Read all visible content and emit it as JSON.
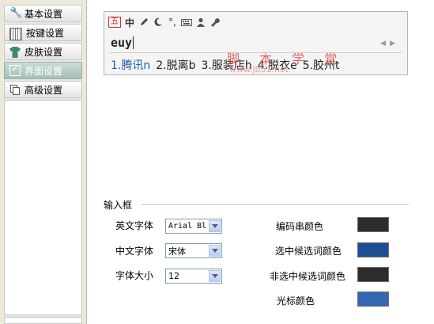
{
  "sidebar": {
    "items": [
      {
        "label": "基本设置",
        "icon": "wrench-icon"
      },
      {
        "label": "按键设置",
        "icon": "keyboard-icon"
      },
      {
        "label": "皮肤设置",
        "icon": "shirt-icon"
      },
      {
        "label": "界面设置",
        "icon": "checkbox-icon",
        "active": true
      },
      {
        "label": "高级设置",
        "icon": "windows-icon"
      }
    ]
  },
  "preview": {
    "toolbar": [
      "五",
      "中",
      "pen-icon",
      "moon-icon",
      "punctuation-icon",
      "keyboard-icon",
      "user-icon",
      "wrench-icon"
    ],
    "toolbar_glyphs": {
      "wubi": "五",
      "lang": "中",
      "punct": "°,"
    },
    "composition": "euy",
    "candidates": [
      "1.腾讯n",
      "2.脱离b",
      "3.服装店h",
      "4.脱衣e",
      "5.胶州t"
    ],
    "watermark": "脚 本 学 堂",
    "watermark_url": "www.jb51.net"
  },
  "input_box": {
    "title": "输入框",
    "english_font": {
      "label": "英文字体",
      "value": "Arial Bl"
    },
    "chinese_font": {
      "label": "中文字体",
      "value": "宋体"
    },
    "font_size": {
      "label": "字体大小",
      "value": "12"
    },
    "colors": [
      {
        "label": "编码串颜色",
        "color": "#2d2d2d"
      },
      {
        "label": "选中候选词颜色",
        "color": "#1c4e96"
      },
      {
        "label": "非选中候选词颜色",
        "color": "#2d2d2d"
      },
      {
        "label": "光标颜色",
        "color": "#3466b4"
      }
    ]
  }
}
